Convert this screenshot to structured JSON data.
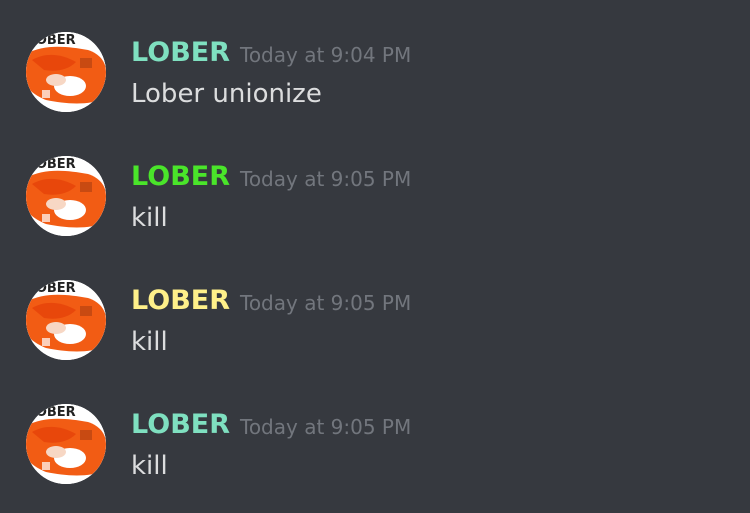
{
  "messages": [
    {
      "username": "LOBER",
      "username_color": "#7fe0c0",
      "timestamp": "Today at 9:04 PM",
      "content": "Lober unionize",
      "avatar_text": "LOBER"
    },
    {
      "username": "LOBER",
      "username_color": "#4ae52a",
      "timestamp": "Today at 9:05 PM",
      "content": "kill",
      "avatar_text": "LOBER"
    },
    {
      "username": "LOBER",
      "username_color": "#fff08a",
      "timestamp": "Today at 9:05 PM",
      "content": "kill",
      "avatar_text": "LOBER"
    },
    {
      "username": "LOBER",
      "username_color": "#7fe0c0",
      "timestamp": "Today at 9:05 PM",
      "content": "kill",
      "avatar_text": "LOBER"
    }
  ],
  "colors": {
    "background": "#36393f",
    "timestamp": "#72767d",
    "message_text": "#dcddde",
    "avatar_orange": "#f25c14"
  }
}
